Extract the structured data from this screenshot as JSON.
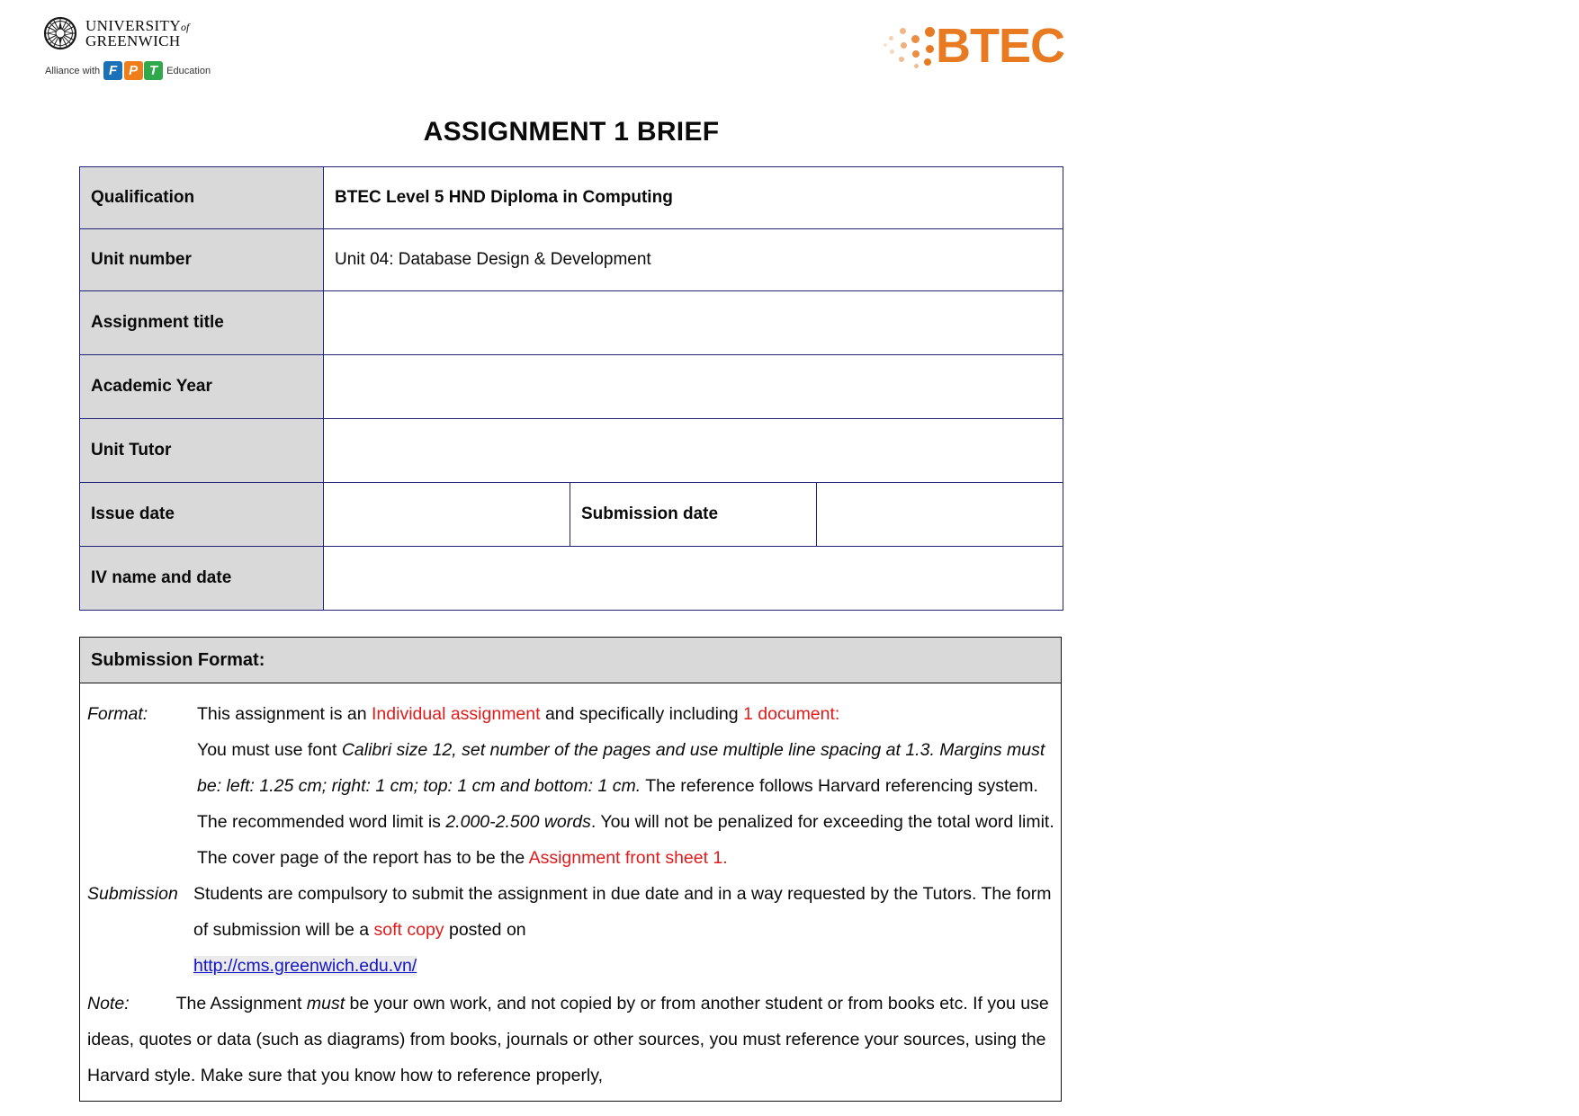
{
  "header": {
    "university_line1": "UNIVERSITY",
    "university_of": "of",
    "university_line2": "GREENWICH",
    "alliance_prefix": "Alliance with",
    "fpt_f": "F",
    "fpt_p": "P",
    "fpt_t": "T",
    "alliance_suffix": "Education",
    "btec_word": "BTEC",
    "brand_orange": "#e87a22",
    "fpt_blue": "#1b71b8",
    "fpt_orange": "#ef7d1a",
    "fpt_green": "#2fa94b"
  },
  "title": "ASSIGNMENT 1 BRIEF",
  "info_table": {
    "rows": [
      {
        "label": "Qualification",
        "value": "BTEC Level 5 HND Diploma in Computing",
        "bold": true
      },
      {
        "label": "Unit number",
        "value": "Unit 04: Database Design & Development",
        "bold": false
      },
      {
        "label": "Assignment title",
        "value": "",
        "bold": false
      },
      {
        "label": "Academic Year",
        "value": "",
        "bold": false
      },
      {
        "label": "Unit Tutor",
        "value": "",
        "bold": false
      },
      {
        "label": "Issue date",
        "value": "",
        "sublabel": "Submission date",
        "subvalue": "",
        "split": true
      },
      {
        "label": "IV name and date",
        "value": "",
        "bold": false
      }
    ]
  },
  "submission_format": {
    "heading": "Submission Format:",
    "format": {
      "tag": "Format:",
      "t1": "This assignment is an ",
      "red1": "Individual assignment",
      "t2": " and specifically including ",
      "red2": "1 document:",
      "t3": "You must use font ",
      "ital1": "Calibri size 12, set number of the pages and use multiple line spacing at 1.3. Margins must be: left: 1.25 cm; right: 1 cm; top: 1 cm and bottom: 1 cm.",
      "t4": " The reference follows Harvard referencing system. The recommended word limit is ",
      "ital2": "2.000-2.500 words",
      "t5": ". You will not be penalized for exceeding the total word limit. The cover page of the report has to be the ",
      "red3": "Assignment front sheet 1."
    },
    "submission": {
      "tag": "Submission",
      "t1": "Students are compulsory to submit the assignment in due date and in a way requested by the Tutors. The form of submission will be a ",
      "red1": "soft copy",
      "t2": " posted on ",
      "link": "http://cms.greenwich.edu.vn/"
    },
    "note": {
      "tag": "Note:",
      "t1": "The Assignment ",
      "ital1": "must",
      "t2": " be your own work, and not copied by or from another student or from books etc. If you use ideas, quotes or data (such as diagrams) from books, journals or other sources, you must reference your sources, using the Harvard style. Make sure that you know how to reference properly,"
    }
  }
}
